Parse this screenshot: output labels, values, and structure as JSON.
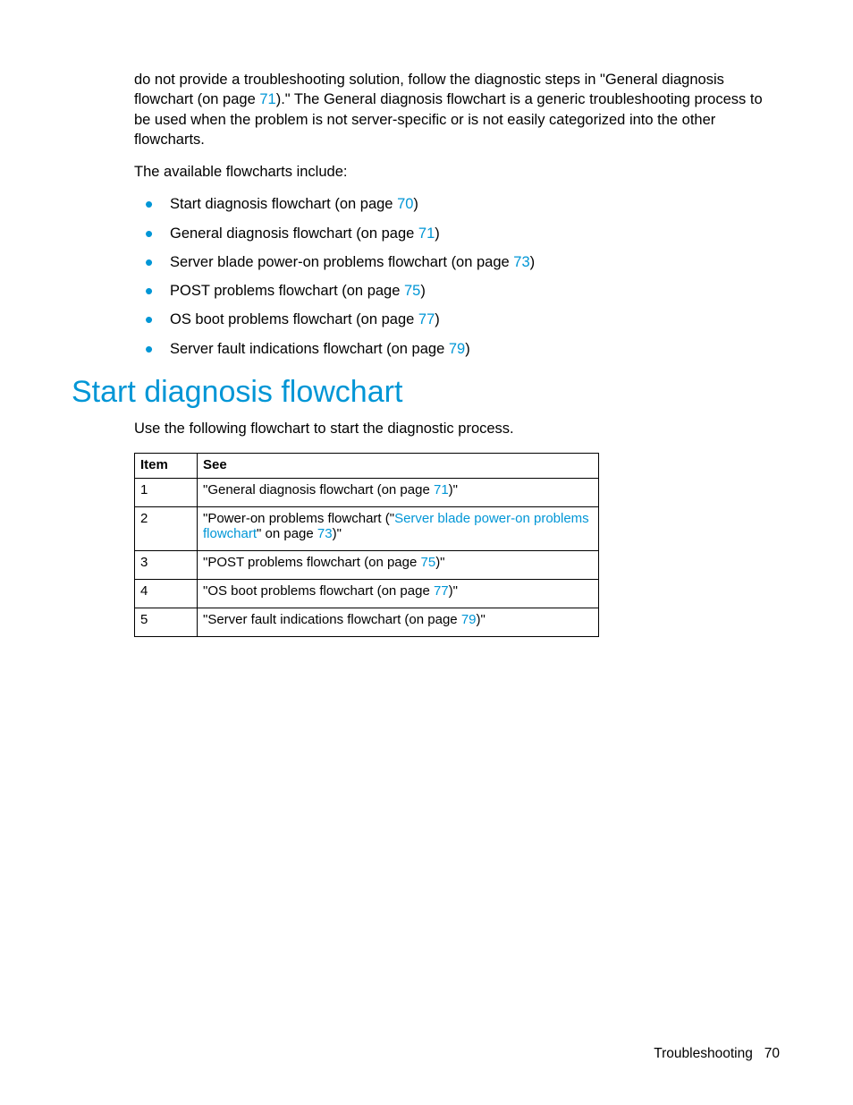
{
  "intro": {
    "p1a": "do not provide a troubleshooting solution, follow the diagnostic steps in \"General diagnosis flowchart (on page ",
    "p1_link": "71",
    "p1b": ").\" The General diagnosis flowchart is a generic troubleshooting process to be used when the problem is not server-specific or is not easily categorized into the other flowcharts.",
    "p2": "The available flowcharts include:"
  },
  "list": [
    {
      "pre": "Start diagnosis flowchart (on page ",
      "link": "70",
      "post": ")"
    },
    {
      "pre": "General diagnosis flowchart (on page ",
      "link": "71",
      "post": ")"
    },
    {
      "pre": "Server blade power-on problems flowchart (on page ",
      "link": "73",
      "post": ")"
    },
    {
      "pre": "POST problems flowchart (on page ",
      "link": "75",
      "post": ")"
    },
    {
      "pre": "OS boot problems flowchart (on page ",
      "link": "77",
      "post": ")"
    },
    {
      "pre": "Server fault indications flowchart (on page ",
      "link": "79",
      "post": ")"
    }
  ],
  "section_title": "Start diagnosis flowchart",
  "section_intro": "Use the following flowchart to start the diagnostic process.",
  "table": {
    "headers": {
      "item": "Item",
      "see": "See"
    },
    "rows": [
      {
        "item": "1",
        "pre": "\"General diagnosis flowchart (on page ",
        "link": "71",
        "post": ")\""
      },
      {
        "item": "2",
        "pre": "\"Power-on problems flowchart (\"",
        "link": "Server blade power-on problems flowchart",
        "mid": "\" on page ",
        "link2": "73",
        "post": ")\""
      },
      {
        "item": "3",
        "pre": "\"POST problems flowchart (on page ",
        "link": "75",
        "post": ")\""
      },
      {
        "item": "4",
        "pre": "\"OS boot problems flowchart (on page ",
        "link": "77",
        "post": ")\""
      },
      {
        "item": "5",
        "pre": "\"Server fault indications flowchart (on page ",
        "link": "79",
        "post": ")\""
      }
    ]
  },
  "footer": {
    "section": "Troubleshooting",
    "page": "70"
  }
}
